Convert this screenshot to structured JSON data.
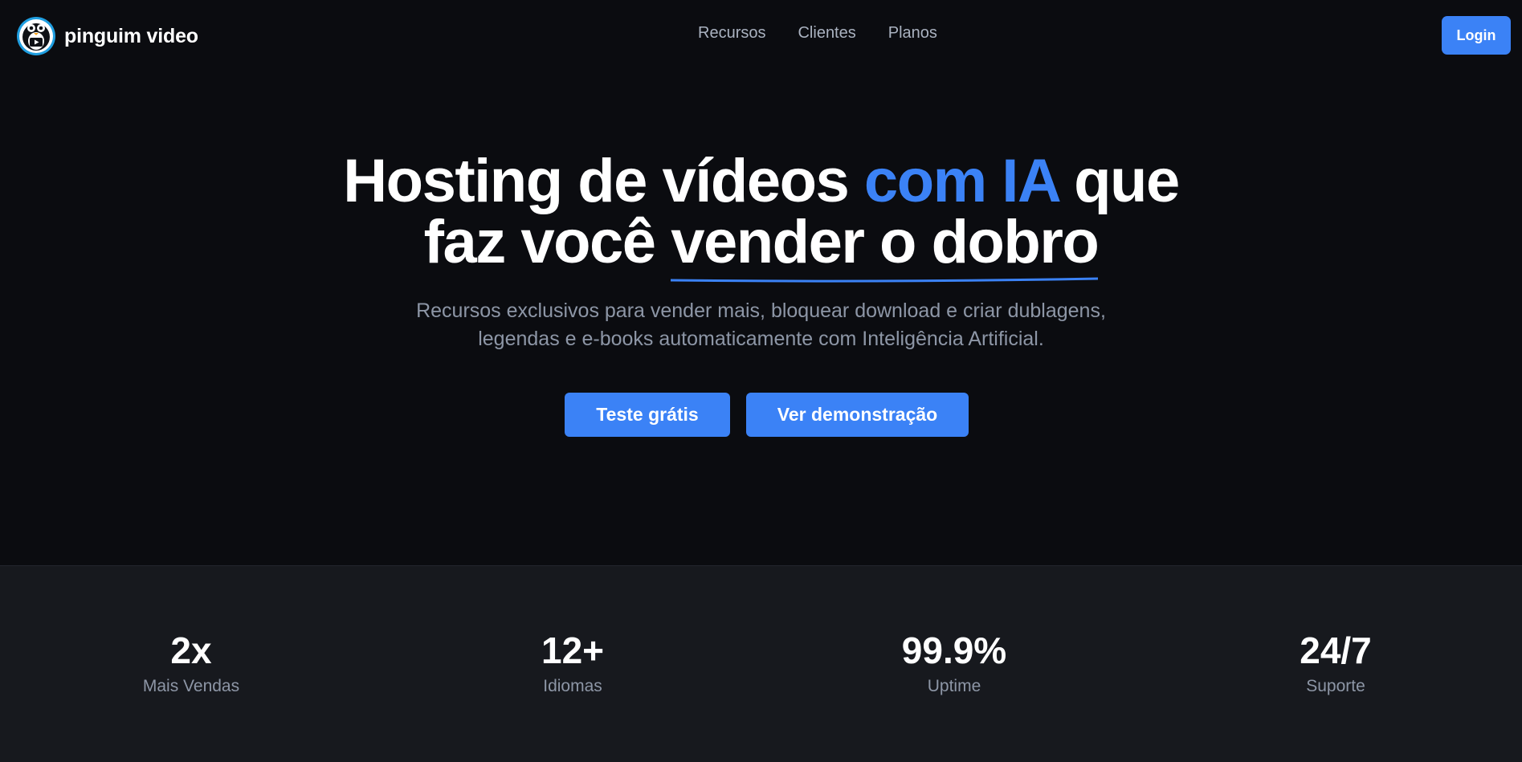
{
  "header": {
    "brand_name": "pinguim video",
    "logo_icon": "penguin-logo-icon",
    "nav": [
      "Recursos",
      "Clientes",
      "Planos"
    ],
    "login_label": "Login"
  },
  "hero": {
    "headline": {
      "line1_before": "Hosting de vídeos ",
      "line1_accent": "com IA",
      "line1_after": " que",
      "line2_before": "faz você ",
      "line2_underlined": "vender o dobro"
    },
    "subtitle": {
      "line1": "Recursos exclusivos para vender mais, bloquear download e criar dublagens,",
      "line2": "legendas e e-books automaticamente com Inteligência Artificial."
    },
    "cta_trial": "Teste grátis",
    "cta_demo": "Ver demonstração"
  },
  "stats": [
    {
      "value": "2x",
      "label": "Mais Vendas"
    },
    {
      "value": "12+",
      "label": "Idiomas"
    },
    {
      "value": "99.9%",
      "label": "Uptime"
    },
    {
      "value": "24/7",
      "label": "Suporte"
    }
  ],
  "colors": {
    "background": "#0b0c10",
    "accent": "#3b82f6",
    "stats_background": "#17191e",
    "muted_text": "#8d96a6"
  }
}
